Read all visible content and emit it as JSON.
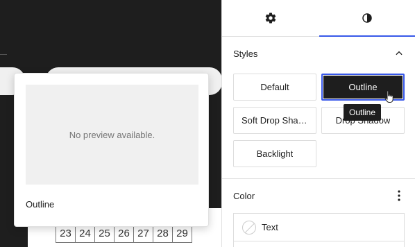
{
  "canvas": {
    "calendar_days": [
      "23",
      "24",
      "25",
      "26",
      "27",
      "28",
      "29"
    ]
  },
  "preview": {
    "empty_text": "No preview available.",
    "style_label": "Outline"
  },
  "sidebar": {
    "tabs": [
      {
        "icon": "gear-icon",
        "label": "Settings",
        "active": false
      },
      {
        "icon": "contrast-icon",
        "label": "Styles",
        "active": true
      }
    ],
    "styles": {
      "title": "Styles",
      "options": [
        {
          "label": "Default",
          "active": false
        },
        {
          "label": "Outline",
          "active": true
        },
        {
          "label": "Soft Drop Shadow",
          "active": false
        },
        {
          "label": "Drop Shadow",
          "active": false
        },
        {
          "label": "Backlight",
          "active": false
        }
      ],
      "tooltip": "Outline"
    },
    "color": {
      "title": "Color",
      "items": [
        {
          "label": "Text"
        }
      ]
    }
  },
  "colors": {
    "accent": "#3858e9",
    "dark": "#1e1e1e",
    "border": "#dddddd"
  }
}
